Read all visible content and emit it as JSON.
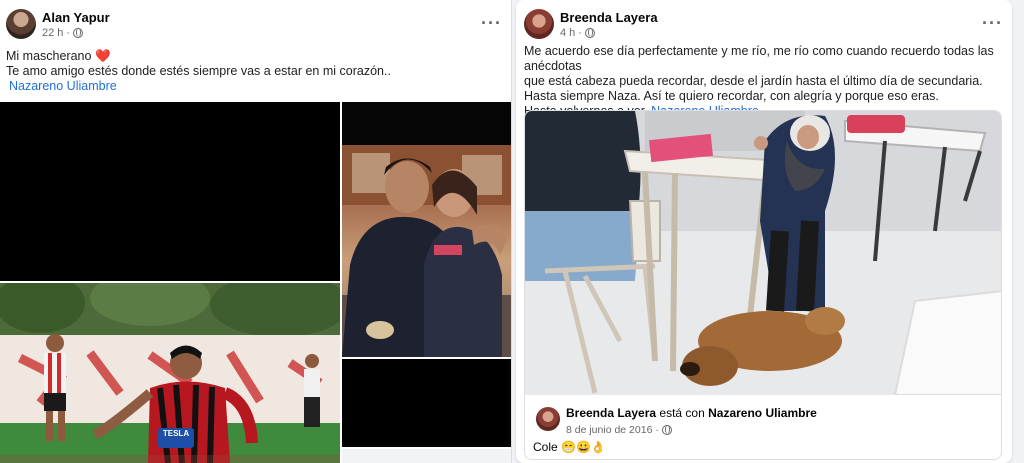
{
  "post1": {
    "author": "Alan Yapur",
    "time": "22 h",
    "lines": [
      "Mi mascherano",
      "Te amo amigo estés donde estés siempre vas a estar en mi corazón.."
    ],
    "heart": "❤️",
    "tag": "Nazareno Uliambre",
    "more": "···",
    "jersey_sponsor": "TESLA"
  },
  "post2": {
    "author": "Breenda Layera",
    "time": "4 h",
    "lines": [
      "Me acuerdo ese día perfectamente y me río, me río como cuando recuerdo todas las anécdotas",
      "que está cabeza pueda recordar, desde el jardín hasta el último día de secundaria.",
      "Hasta siempre Naza. Así te quiero recordar, con alegría y porque eso eras.",
      "Hasta volvernos a ver."
    ],
    "tag": "Nazareno Uliambre",
    "more": "···",
    "shared": {
      "author": "Breenda Layera",
      "with_word": "está con",
      "with_name": "Nazareno Uliambre",
      "date": "8 de junio de 2016",
      "text": "Cole",
      "emojis": "😁😀👌"
    }
  },
  "colors": {
    "link": "#216fdb",
    "meta": "#65676b",
    "page_bg": "#f0f2f5"
  }
}
